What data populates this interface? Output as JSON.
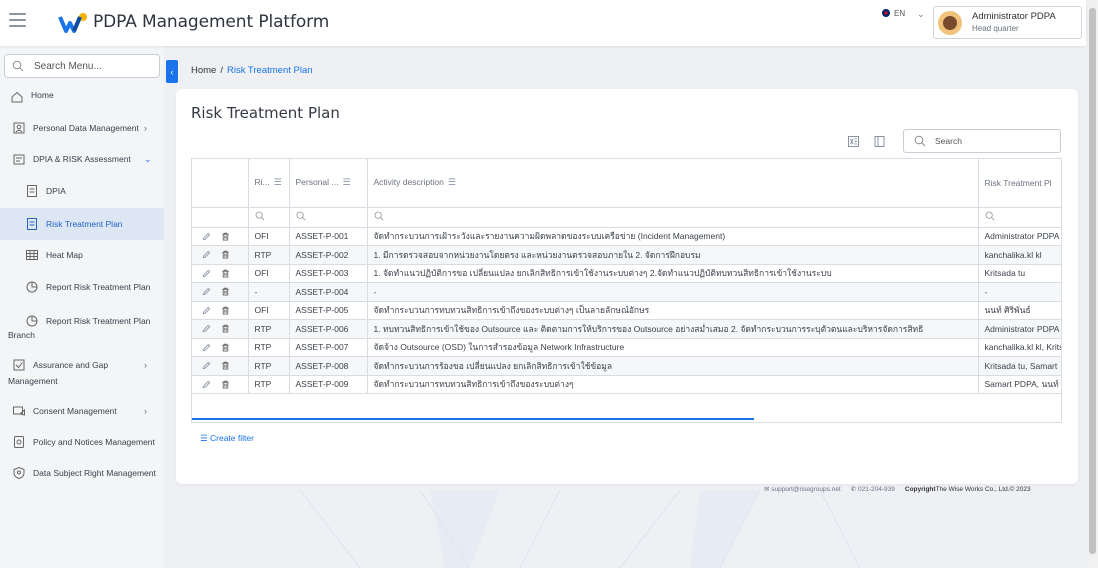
{
  "header": {
    "app_title": "PDPA Management Platform",
    "lang": "EN",
    "user_name": "Administrator PDPA",
    "user_sub": "Head quarter"
  },
  "sidebar": {
    "search_placeholder": "Search Menu...",
    "items": [
      {
        "label": "Home",
        "icon": "home-icon"
      },
      {
        "label": "Personal Data Management",
        "icon": "personal-data-icon",
        "chevron": ">"
      },
      {
        "label": "DPIA & RISK Assessment",
        "icon": "dpia-icon",
        "chevron": "v"
      },
      {
        "label": "DPIA",
        "icon": "document-icon"
      },
      {
        "label": "Risk Treatment Plan",
        "icon": "document-icon",
        "active": true
      },
      {
        "label": "Heat Map",
        "icon": "grid-icon"
      },
      {
        "label": "Report Risk Treatment Plan",
        "icon": "report-icon"
      },
      {
        "label": "Report Risk Treatment Plan",
        "label2": "Branch",
        "icon": "report-icon"
      },
      {
        "label": "Assurance and Gap",
        "label2": "Management",
        "icon": "assurance-icon",
        "chevron": ">"
      },
      {
        "label": "Consent Management",
        "icon": "consent-icon",
        "chevron": ">"
      },
      {
        "label": "Policy and Notices Management",
        "icon": "policy-icon"
      },
      {
        "label": "Data Subject Right Management",
        "icon": "dsr-icon"
      }
    ]
  },
  "breadcrumb": {
    "home": "Home",
    "sep": "/",
    "current": "Risk Treatment Plan"
  },
  "page": {
    "title": "Risk Treatment Plan",
    "search_placeholder": "Search",
    "create_filter": "Create filter"
  },
  "table": {
    "columns": [
      "Ri...",
      "Personal ...",
      "Activity description",
      "Risk Treatment Pl"
    ],
    "rows": [
      {
        "type": "OFI",
        "asset": "ASSET-P-001",
        "desc": "จัดทำกระบวนการเฝ้าระวังและรายงานความผิดพลาดของระบบเครือข่าย (Incident Management)",
        "owner": "Administrator PDPA"
      },
      {
        "type": "RTP",
        "asset": "ASSET-P-002",
        "desc": "1. มีการตรวจสอบจากหน่วยงานโดยตรง และหน่วยงานตรวจสอบภายใน 2. จัดการฝึกอบรม",
        "owner": "kanchalika.kl kl"
      },
      {
        "type": "OFI",
        "asset": "ASSET-P-003",
        "desc": "1. จัดทำแนวปฏิบัติการขอ เปลี่ยนแปลง ยกเลิกสิทธิการเข้าใช้งานระบบต่างๆ 2.จัดทำแนวปฏิบัติทบทวนสิทธิการเข้าใช้งานระบบ",
        "owner": "Kritsada tu"
      },
      {
        "type": "-",
        "asset": "ASSET-P-004",
        "desc": "-",
        "owner": "-"
      },
      {
        "type": "OFI",
        "asset": "ASSET-P-005",
        "desc": "จัดทำกระบวนการทบทวนสิทธิการเข้าถึงของระบบต่างๆ เป็นลายลักษณ์อักษร",
        "owner": "นนท์ ศิริพันธ์"
      },
      {
        "type": "RTP",
        "asset": "ASSET-P-006",
        "desc": "1. ทบทวนสิทธิการเข้าใช้ของ Outsource และ ติดตามการให้บริการของ Outsource อย่างสม่ำเสมอ 2. จัดทำกระบวนการระบุตัวตนและบริหารจัดการสิทธิ",
        "owner": "Administrator PDPA"
      },
      {
        "type": "RTP",
        "asset": "ASSET-P-007",
        "desc": "จัดจ้าง Outsource (OSD) ในการสำรองข้อมูล Network Infrastructure",
        "owner": "kanchalika.kl kl, Kritsada"
      },
      {
        "type": "RTP",
        "asset": "ASSET-P-008",
        "desc": "จัดทำกระบวนการร้องขอ เปลี่ยนแปลง ยกเลิกสิทธิการเข้าใช้ข้อมูล",
        "owner": "Kritsada tu, Samart"
      },
      {
        "type": "RTP",
        "asset": "ASSET-P-009",
        "desc": "จัดทำกระบวนการทบทวนสิทธิการเข้าถึงของระบบต่างๆ",
        "owner": "Samart PDPA, นนท์"
      }
    ]
  },
  "footer": {
    "email": "support@risegroups.net",
    "phone": "021-204-939",
    "copyright_label": "Copyright",
    "copyright": "The Wise Works Co., Ltd.© 2023"
  },
  "colors": {
    "accent": "#1a73e8",
    "active_bg": "#dde6f3"
  }
}
